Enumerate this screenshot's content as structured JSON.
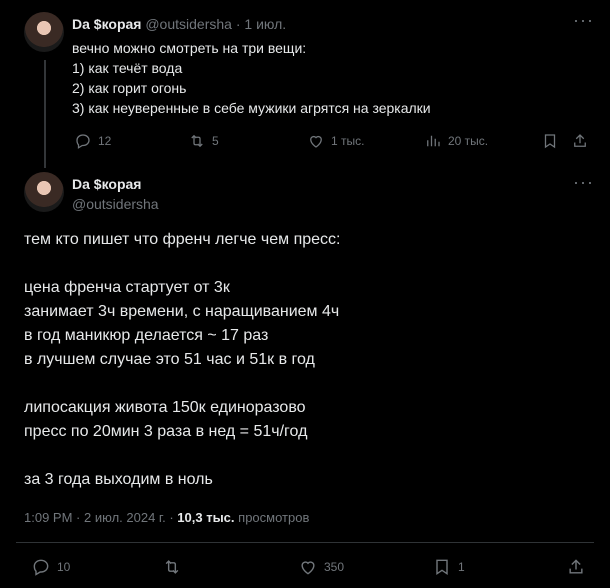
{
  "reply_tweet": {
    "display_name": "Da $корая",
    "handle": "@outsidersha",
    "sep": "·",
    "date": "1 июл.",
    "lines": [
      "вечно можно смотреть на три вещи:",
      "1) как течёт вода",
      "2) как горит огонь",
      "3) как неуверенные в себе мужики агрятся на зеркалки"
    ],
    "actions": {
      "replies": "12",
      "reposts": "5",
      "likes": "1 тыс.",
      "views": "20 тыс."
    },
    "more_icon": "more-dots-icon"
  },
  "main_tweet": {
    "display_name": "Da $корая",
    "handle": "@outsidersha",
    "lines": [
      "тем кто пишет что френч легче чем пресс:",
      "",
      "цена френча стартует от 3к",
      "занимает 3ч времени, с наращиванием 4ч",
      "в год маникюр делается ~ 17 раз",
      "в лучшем случае это 51 час и 51к в год",
      "",
      "липосакция живота 150к единоразово",
      "пресс по 20мин 3 раза в нед = 51ч/год",
      "",
      "за 3 года выходим в ноль"
    ],
    "meta": {
      "time": "1:09 PM",
      "sep": "·",
      "date": "2 июл. 2024 г.",
      "sep2": "·",
      "views_count": "10,3 тыс.",
      "views_label": "просмотров"
    },
    "actions": {
      "replies": "10",
      "likes": "350",
      "bookmarks": "1"
    }
  },
  "colors": {
    "background": "#000000",
    "text": "#e7e9ea",
    "muted": "#71767b",
    "divider": "#2f3336"
  }
}
